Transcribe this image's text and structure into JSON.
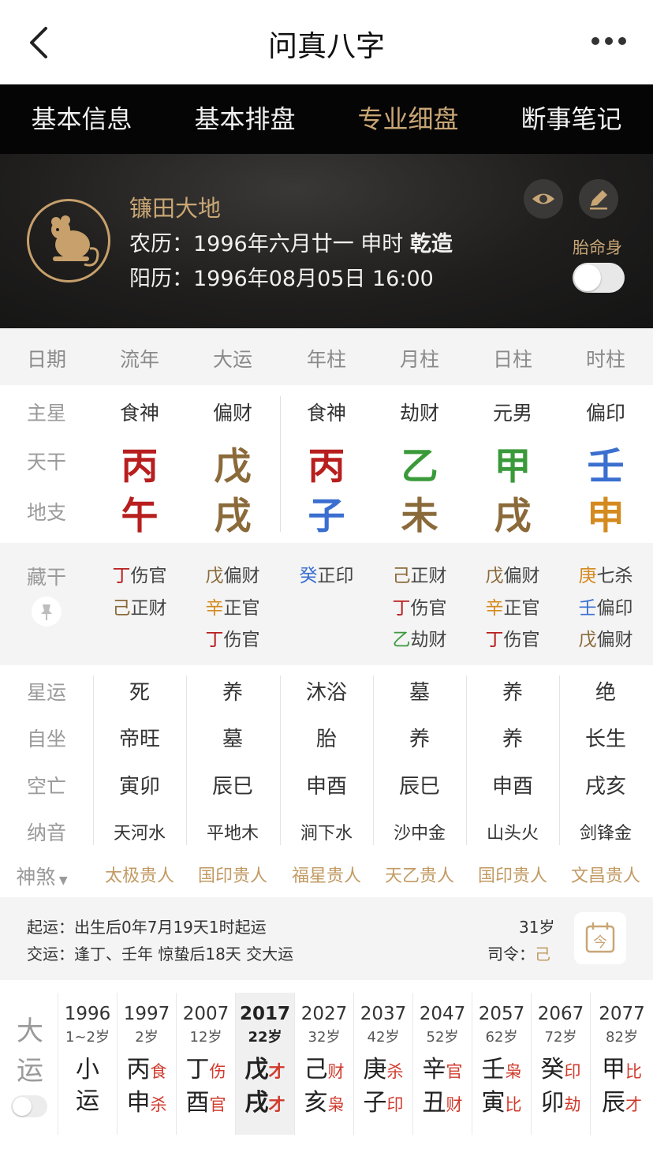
{
  "nav": {
    "title": "问真八字"
  },
  "tabs": [
    "基本信息",
    "基本排盘",
    "专业细盘",
    "断事笔记"
  ],
  "profile": {
    "name": "镰田大地",
    "lunar_label": "农历：",
    "lunar_value": "1996年六月廿一 申时",
    "gender_tag": "乾造",
    "solar_label": "阳历：",
    "solar_value": "1996年08月05日 16:00",
    "taiming_label": "胎命身"
  },
  "header": [
    "日期",
    "流年",
    "大运",
    "年柱",
    "月柱",
    "日柱",
    "时柱"
  ],
  "row_labels": {
    "main_star": "主星",
    "stem": "天干",
    "branch": "地支",
    "hidden": "藏干"
  },
  "main_star": [
    "食神",
    "偏财",
    "食神",
    "劫财",
    "元男",
    "偏印"
  ],
  "stems": [
    "丙",
    "戊",
    "丙",
    "乙",
    "甲",
    "壬"
  ],
  "branches": [
    "午",
    "戌",
    "子",
    "未",
    "戌",
    "申"
  ],
  "colors": {
    "fire": "#b81e1e",
    "earth": "#8b6a3a",
    "water": "#3a6fd0",
    "wood": "#3a9a3a",
    "metal": "#d48a1e",
    "gold": "#c9a675",
    "shensha": "#c29a63",
    "relation": "#d03a2c"
  },
  "hidden_stems": [
    [
      {
        "g": "丁",
        "t": "伤官"
      },
      {
        "g": "己",
        "t": "正财"
      }
    ],
    [
      {
        "g": "戊",
        "t": "偏财"
      },
      {
        "g": "辛",
        "t": "正官"
      },
      {
        "g": "丁",
        "t": "伤官"
      }
    ],
    [
      {
        "g": "癸",
        "t": "正印"
      }
    ],
    [
      {
        "g": "己",
        "t": "正财"
      },
      {
        "g": "丁",
        "t": "伤官"
      },
      {
        "g": "乙",
        "t": "劫财"
      }
    ],
    [
      {
        "g": "戊",
        "t": "偏财"
      },
      {
        "g": "辛",
        "t": "正官"
      },
      {
        "g": "丁",
        "t": "伤官"
      }
    ],
    [
      {
        "g": "庚",
        "t": "七杀"
      },
      {
        "g": "壬",
        "t": "偏印"
      },
      {
        "g": "戊",
        "t": "偏财"
      }
    ]
  ],
  "star_section": {
    "labels": [
      "星运",
      "自坐",
      "空亡",
      "纳音",
      "神煞"
    ],
    "xingyun": [
      "死",
      "养",
      "沐浴",
      "墓",
      "养",
      "绝"
    ],
    "zizuo": [
      "帝旺",
      "墓",
      "胎",
      "养",
      "养",
      "长生"
    ],
    "kongwang": [
      "寅卯",
      "辰巳",
      "申酉",
      "辰巳",
      "申酉",
      "戌亥"
    ],
    "nayin": [
      "天河水",
      "平地木",
      "涧下水",
      "沙中金",
      "山头火",
      "剑锋金"
    ],
    "shensha": [
      "太极贵人",
      "国印贵人",
      "福星贵人",
      "天乙贵人",
      "国印贵人",
      "文昌贵人"
    ]
  },
  "luck_info": {
    "qiyun": "起运：出生后0年7月19天1时起运",
    "jiaoyun": "交运：逢丁、壬年 惊蛰后18天 交大运",
    "age": "31岁",
    "siling_label": "司令：",
    "siling_value": "己"
  },
  "dayun": {
    "label": "大运",
    "columns": [
      {
        "year": "1996",
        "age": "1~2岁",
        "stem": "小",
        "branch": "运",
        "sr": "",
        "br": ""
      },
      {
        "year": "1997",
        "age": "2岁",
        "stem": "丙",
        "branch": "申",
        "sr": "食",
        "br": "杀"
      },
      {
        "year": "2007",
        "age": "12岁",
        "stem": "丁",
        "branch": "酉",
        "sr": "伤",
        "br": "官"
      },
      {
        "year": "2017",
        "age": "22岁",
        "stem": "戊",
        "branch": "戌",
        "sr": "才",
        "br": "才"
      },
      {
        "year": "2027",
        "age": "32岁",
        "stem": "己",
        "branch": "亥",
        "sr": "财",
        "br": "枭"
      },
      {
        "year": "2037",
        "age": "42岁",
        "stem": "庚",
        "branch": "子",
        "sr": "杀",
        "br": "印"
      },
      {
        "year": "2047",
        "age": "52岁",
        "stem": "辛",
        "branch": "丑",
        "sr": "官",
        "br": "财"
      },
      {
        "year": "2057",
        "age": "62岁",
        "stem": "壬",
        "branch": "寅",
        "sr": "枭",
        "br": "比"
      },
      {
        "year": "2067",
        "age": "72岁",
        "stem": "癸",
        "branch": "卯",
        "sr": "印",
        "br": "劫"
      },
      {
        "year": "2077",
        "age": "82岁",
        "stem": "甲",
        "branch": "辰",
        "sr": "比",
        "br": "才"
      }
    ]
  }
}
